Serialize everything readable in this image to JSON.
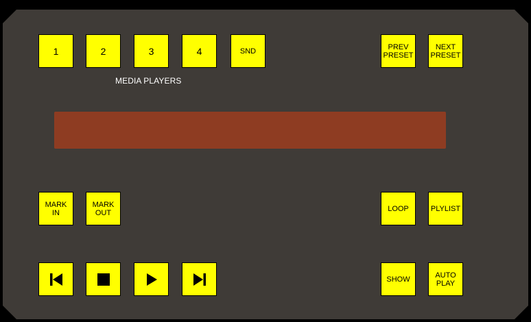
{
  "media_players": {
    "label": "MEDIA PLAYERS",
    "buttons": [
      "1",
      "2",
      "3",
      "4",
      "SND"
    ]
  },
  "preset": {
    "prev_label": "PREV\nPRESET",
    "next_label": "NEXT\nPRESET"
  },
  "display": {
    "text": ""
  },
  "marks": {
    "mark_in_label": "MARK\nIN",
    "mark_out_label": "MARK\nOUT"
  },
  "right_controls": {
    "loop_label": "LOOP",
    "playlist_label": "PLYLIST",
    "show_label": "SHOW",
    "auto_play_label": "AUTO\nPLAY"
  },
  "transport": {
    "icons": [
      "skip-back-icon",
      "stop-icon",
      "play-icon",
      "skip-forward-icon"
    ]
  },
  "colors": {
    "panel": "#3f3b37",
    "button": "#ffff00",
    "display": "#8e3c22",
    "label_text": "#ffffff"
  }
}
